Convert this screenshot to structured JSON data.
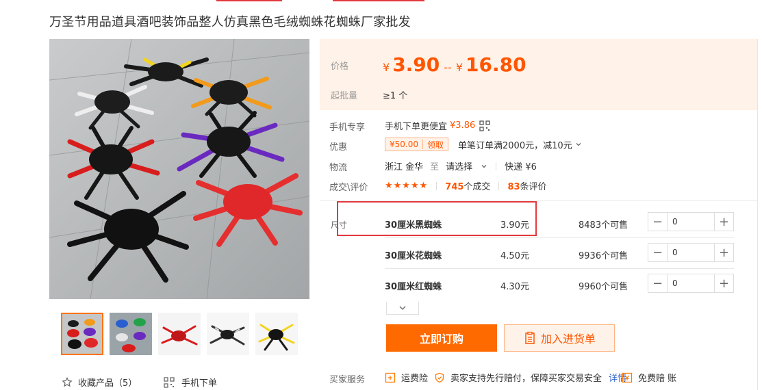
{
  "product": {
    "title": "万圣节用品道具酒吧装饰品整人仿真黑色毛绒蜘蛛花蜘蛛厂家批发"
  },
  "gallery": {
    "favorite_label": "收藏产品（5）",
    "mobile_order_label": "手机下单",
    "thumbs": [
      "mixed-spiders",
      "colorful-spiders",
      "red-spider",
      "black-white-spider",
      "yellow-black-spider"
    ]
  },
  "price": {
    "label": "价格",
    "currency": "¥",
    "low": "3.90",
    "separator": "--",
    "high": "16.80",
    "moq_label": "起批量",
    "moq_value": "≥1 个"
  },
  "info": {
    "mobile_label": "手机专享",
    "mobile_text": "手机下单更便宜",
    "mobile_price": "¥3.86",
    "discount_label": "优惠",
    "coupon_amount": "¥50.00",
    "coupon_action": "领取",
    "discount_text": "单笔订单满2000元，减10元",
    "logistics_label": "物流",
    "origin": "浙江 金华",
    "to": "至",
    "destination": "请选择",
    "express": "快递 ¥6",
    "deals_label": "成交\\评价",
    "stars": "★★★★★",
    "deal_count": "745",
    "deal_suffix": "个成交",
    "review_count": "83",
    "review_suffix": "条评价"
  },
  "sku": {
    "label": "尺寸",
    "rows": [
      {
        "name": "30厘米黑蜘蛛",
        "price": "3.90元",
        "stock": "8483个可售",
        "qty": "0"
      },
      {
        "name": "30厘米花蜘蛛",
        "price": "4.50元",
        "stock": "9936个可售",
        "qty": "0"
      },
      {
        "name": "30厘米红蜘蛛",
        "price": "4.30元",
        "stock": "9960个可售",
        "qty": "0"
      }
    ],
    "minus": "−",
    "plus": "+"
  },
  "actions": {
    "order": "立即订购",
    "add_to_cart": "加入进货单"
  },
  "services": {
    "label": "买家服务",
    "shipping_insurance": "运费险",
    "guarantee": "卖家支持先行赔付，保障买家交易安全",
    "details_link": "详情",
    "free_compensation": "免费赔 账"
  },
  "colors": {
    "accent": "#ff5500",
    "button": "#ff6a00",
    "highlight": "#e4393c",
    "price_bg": "#fff2e8"
  }
}
